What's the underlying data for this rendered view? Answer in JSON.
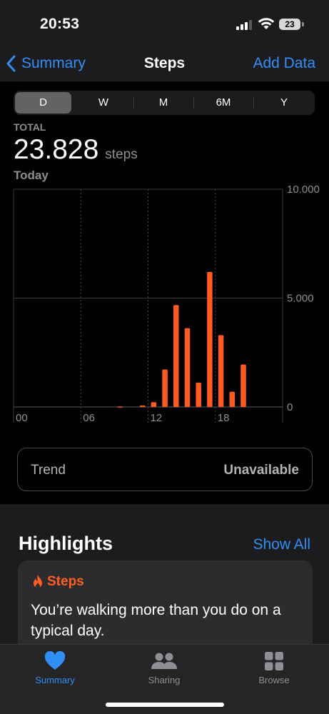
{
  "status_bar": {
    "time": "20:53",
    "battery": "23"
  },
  "nav": {
    "back_label": "Summary",
    "title": "Steps",
    "action_label": "Add Data"
  },
  "segments": [
    {
      "label": "D",
      "selected": true
    },
    {
      "label": "W",
      "selected": false
    },
    {
      "label": "M",
      "selected": false
    },
    {
      "label": "6M",
      "selected": false
    },
    {
      "label": "Y",
      "selected": false
    }
  ],
  "summary": {
    "label": "TOTAL",
    "value": "23.828",
    "unit": "steps",
    "period": "Today"
  },
  "chart_data": {
    "type": "bar",
    "title": "",
    "xlabel": "",
    "ylabel": "",
    "x_ticks": [
      "00",
      "06",
      "12",
      "18"
    ],
    "y_ticks": [
      "0",
      "5.000",
      "10.000"
    ],
    "ylim": [
      0,
      10000
    ],
    "hours": [
      0,
      1,
      2,
      3,
      4,
      5,
      6,
      7,
      8,
      9,
      10,
      11,
      12,
      13,
      14,
      15,
      16,
      17,
      18,
      19,
      20,
      21,
      22,
      23
    ],
    "values": [
      0,
      0,
      0,
      0,
      0,
      0,
      0,
      0,
      0,
      20,
      0,
      70,
      220,
      1720,
      4680,
      3620,
      1120,
      6200,
      3300,
      700,
      1950,
      0,
      0,
      0
    ],
    "color": "#ff5a1f",
    "grid": true
  },
  "trend": {
    "label": "Trend",
    "value": "Unavailable"
  },
  "highlights": {
    "title": "Highlights",
    "show_all": "Show All",
    "card": {
      "category": "Steps",
      "icon": "flame-icon",
      "text": "You’re walking more than you do on a typical day."
    }
  },
  "tabs": [
    {
      "label": "Summary",
      "icon": "heart-icon",
      "active": true
    },
    {
      "label": "Sharing",
      "icon": "people-icon",
      "active": false
    },
    {
      "label": "Browse",
      "icon": "grid-icon",
      "active": false
    }
  ],
  "colors": {
    "accent": "#2f8ff5",
    "bars": "#ff5a1f",
    "background": "#000000",
    "surface": "#1c1c1e"
  }
}
